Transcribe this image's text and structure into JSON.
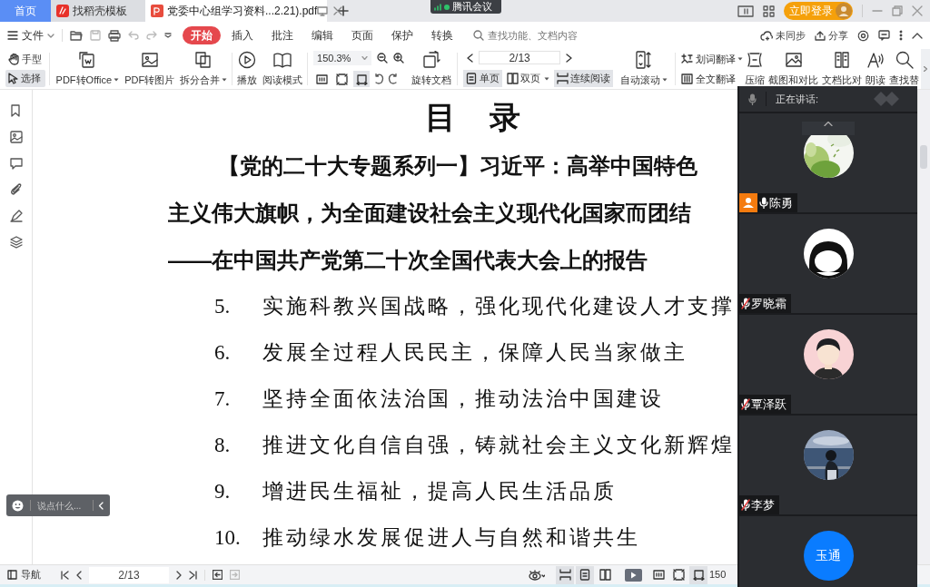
{
  "title_bar": {
    "tabs": [
      {
        "label": "首页",
        "kind": "home",
        "selected": false
      },
      {
        "label": "找稻壳模板",
        "kind": "template",
        "selected": false
      },
      {
        "label": "党委中心组学习资料...2.21).pdf",
        "kind": "pdf",
        "selected": true
      }
    ],
    "meeting_badge": "腾讯会议",
    "login": "立即登录"
  },
  "menu_bar": {
    "file": "文件",
    "tabs": [
      {
        "label": "开始",
        "selected": true
      },
      {
        "label": "插入",
        "selected": false
      },
      {
        "label": "批注",
        "selected": false
      },
      {
        "label": "编辑",
        "selected": false
      },
      {
        "label": "页面",
        "selected": false
      },
      {
        "label": "保护",
        "selected": false
      },
      {
        "label": "转换",
        "selected": false
      }
    ],
    "search": {
      "placeholder": "查找功能、文档内容"
    },
    "sync": "未同步",
    "share": "分享"
  },
  "ribbon": {
    "tools": [
      {
        "label": "手型",
        "selected": false
      },
      {
        "label": "选择",
        "selected": true
      }
    ],
    "buttons": [
      {
        "label": "PDF转Office",
        "dropdown": true
      },
      {
        "label": "PDF转图片",
        "dropdown": false
      },
      {
        "label": "拆分合并",
        "dropdown": true
      },
      {
        "label": "播放",
        "dropdown": false
      },
      {
        "label": "阅读模式",
        "dropdown": false
      }
    ],
    "zoom": "150.3%",
    "fit_modes": [
      {
        "selected": false
      },
      {
        "selected": false
      },
      {
        "selected": true
      }
    ],
    "rotate": "旋转文档",
    "page": "2/13",
    "views": [
      {
        "label": "单页",
        "selected": true,
        "dropdown": false
      },
      {
        "label": "双页",
        "selected": false,
        "dropdown": true
      },
      {
        "label": "连续阅读",
        "selected": true,
        "dropdown": false
      }
    ],
    "auto_scroll": "自动滚动",
    "translate": [
      {
        "label": "划词翻译",
        "dropdown": true
      },
      {
        "label": "全文翻译",
        "dropdown": false
      }
    ],
    "tools_right": [
      "压缩",
      "截图和对比",
      "文档比对",
      "朗读",
      "查找替"
    ]
  },
  "document": {
    "title": "目 录",
    "heading_lines": [
      "【党的二十大专题系列一】习近平：高举中国特色",
      "主义伟大旗帜，为全面建设社会主义现代化国家而团结",
      "——在中国共产党第二十次全国代表大会上的报告"
    ],
    "items": [
      {
        "number": "5.",
        "text": "实施科教兴国战略，强化现代化建设人才支撑"
      },
      {
        "number": "6.",
        "text": "发展全过程人民民主，保障人民当家做主"
      },
      {
        "number": "7.",
        "text": "坚持全面依法治国，推动法治中国建设"
      },
      {
        "number": "8.",
        "text": "推进文化自信自强，铸就社会主义文化新辉煌"
      },
      {
        "number": "9.",
        "text": "增进民生福祉，提高人民生活品质"
      },
      {
        "number": "10.",
        "text": "推动绿水发展促进人与自然和谐共生"
      }
    ]
  },
  "chat": {
    "placeholder": "说点什么..."
  },
  "meeting_panel": {
    "header": "正在讲话:",
    "participants": [
      {
        "name": "陈勇",
        "muted": false,
        "host": true
      },
      {
        "name": "罗晓霜",
        "muted": true,
        "host": false
      },
      {
        "name": "覃泽跃",
        "muted": true,
        "host": false
      },
      {
        "name": "李梦",
        "muted": true,
        "host": false
      },
      {
        "avatar": {
          "kind": "initials",
          "text": "玉通",
          "color": "#0a7cff"
        }
      }
    ]
  },
  "status_bar": {
    "nav": "导航",
    "page": "2/13",
    "view_modes": [
      {
        "selected": true
      },
      {
        "selected": true
      },
      {
        "selected": false
      }
    ],
    "fit_modes": [
      {
        "selected": false
      },
      {
        "selected": false
      },
      {
        "selected": true
      }
    ],
    "zoom": "150"
  }
}
